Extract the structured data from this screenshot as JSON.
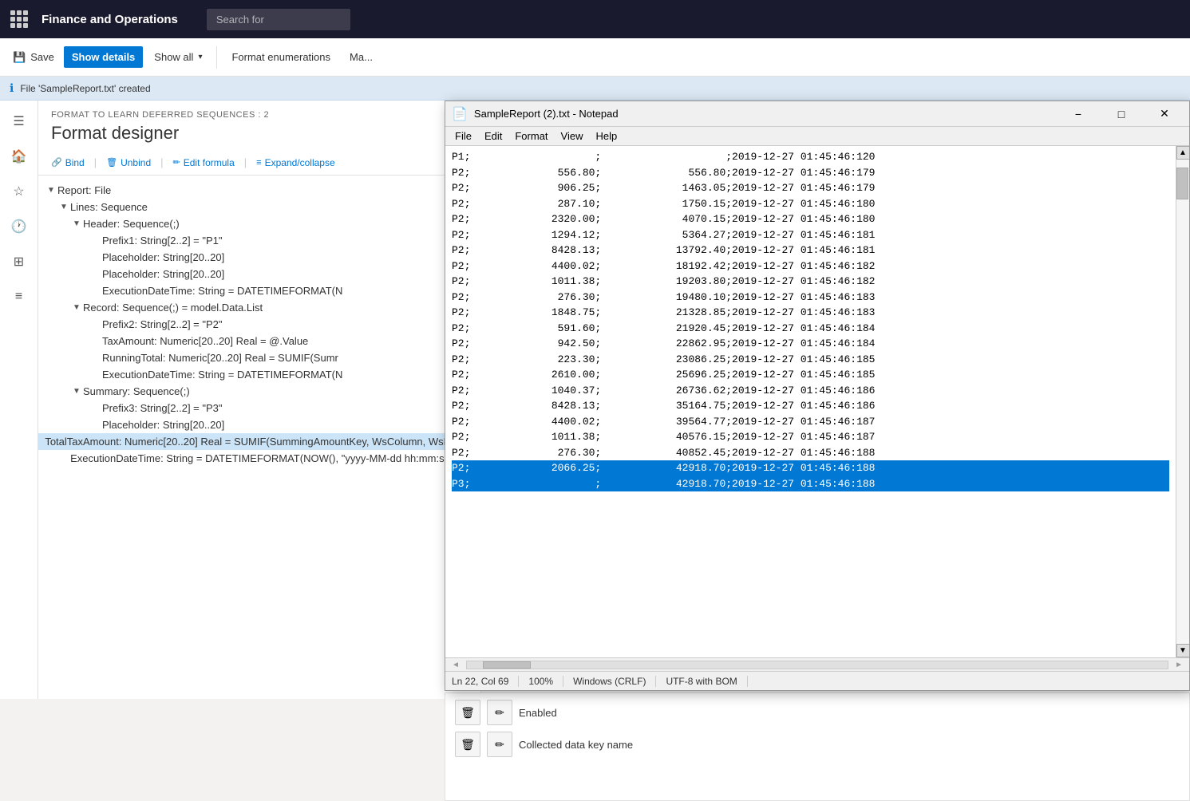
{
  "app": {
    "title": "Finance and Operations",
    "search_placeholder": "Search for"
  },
  "toolbar": {
    "save_label": "Save",
    "show_details_label": "Show details",
    "show_all_label": "Show all",
    "format_enumerations_label": "Format enumerations",
    "manage_label": "Ma..."
  },
  "info_bar": {
    "message": "File 'SampleReport.txt' created"
  },
  "designer": {
    "subtitle": "FORMAT TO LEARN DEFERRED SEQUENCES : 2",
    "title": "Format designer",
    "actions": {
      "bind": "Bind",
      "unbind": "Unbind",
      "edit_formula": "Edit formula",
      "expand_collapse": "Expand/collapse"
    },
    "tree": [
      {
        "level": 0,
        "arrow": "▼",
        "label": "Report: File",
        "indent": 0
      },
      {
        "level": 1,
        "arrow": "▼",
        "label": "Lines: Sequence",
        "indent": 16
      },
      {
        "level": 2,
        "arrow": "▼",
        "label": "Header: Sequence(;)",
        "indent": 32
      },
      {
        "level": 3,
        "arrow": "",
        "label": "Prefix1: String[2..2] = \"P1\"",
        "indent": 56
      },
      {
        "level": 3,
        "arrow": "",
        "label": "Placeholder: String[20..20]",
        "indent": 56
      },
      {
        "level": 3,
        "arrow": "",
        "label": "Placeholder: String[20..20]",
        "indent": 56
      },
      {
        "level": 3,
        "arrow": "",
        "label": "ExecutionDateTime: String = DATETIMEFORMAT(N",
        "indent": 56
      },
      {
        "level": 2,
        "arrow": "▼",
        "label": "Record: Sequence(;) = model.Data.List",
        "indent": 32
      },
      {
        "level": 3,
        "arrow": "",
        "label": "Prefix2: String[2..2] = \"P2\"",
        "indent": 56
      },
      {
        "level": 3,
        "arrow": "",
        "label": "TaxAmount: Numeric[20..20] Real = @.Value",
        "indent": 56
      },
      {
        "level": 3,
        "arrow": "",
        "label": "RunningTotal: Numeric[20..20] Real = SUMIF(Sumr",
        "indent": 56
      },
      {
        "level": 3,
        "arrow": "",
        "label": "ExecutionDateTime: String = DATETIMEFORMAT(N",
        "indent": 56
      },
      {
        "level": 2,
        "arrow": "▼",
        "label": "Summary: Sequence(;)",
        "indent": 32
      },
      {
        "level": 3,
        "arrow": "",
        "label": "Prefix3: String[2..2] = \"P3\"",
        "indent": 56
      },
      {
        "level": 3,
        "arrow": "",
        "label": "Placeholder: String[20..20]",
        "indent": 56
      },
      {
        "level": 3,
        "arrow": "",
        "label": "TotalTaxAmount: Numeric[20..20] Real = SUMIF(SummingAmountKey, WsColumn, WsRow)",
        "indent": 56,
        "selected": true
      },
      {
        "level": 3,
        "arrow": "",
        "label": "ExecutionDateTime: String = DATETIMEFORMAT(NOW(), \"yyyy-MM-dd hh:mm:ss:fff\")",
        "indent": 56
      }
    ]
  },
  "notepad": {
    "title": "SampleReport (2).txt - Notepad",
    "menu": [
      "File",
      "Edit",
      "Format",
      "View",
      "Help"
    ],
    "lines": [
      {
        "text": "P1;                    ;                    ;2019-12-27 01:45:46:120",
        "selected": false
      },
      {
        "text": "P2;              556.80;              556.80;2019-12-27 01:45:46:179",
        "selected": false
      },
      {
        "text": "P2;              906.25;             1463.05;2019-12-27 01:45:46:179",
        "selected": false
      },
      {
        "text": "P2;              287.10;             1750.15;2019-12-27 01:45:46:180",
        "selected": false
      },
      {
        "text": "P2;             2320.00;             4070.15;2019-12-27 01:45:46:180",
        "selected": false
      },
      {
        "text": "P2;             1294.12;             5364.27;2019-12-27 01:45:46:181",
        "selected": false
      },
      {
        "text": "P2;             8428.13;            13792.40;2019-12-27 01:45:46:181",
        "selected": false
      },
      {
        "text": "P2;             4400.02;            18192.42;2019-12-27 01:45:46:182",
        "selected": false
      },
      {
        "text": "P2;             1011.38;            19203.80;2019-12-27 01:45:46:182",
        "selected": false
      },
      {
        "text": "P2;              276.30;            19480.10;2019-12-27 01:45:46:183",
        "selected": false
      },
      {
        "text": "P2;             1848.75;            21328.85;2019-12-27 01:45:46:183",
        "selected": false
      },
      {
        "text": "P2;              591.60;            21920.45;2019-12-27 01:45:46:184",
        "selected": false
      },
      {
        "text": "P2;              942.50;            22862.95;2019-12-27 01:45:46:184",
        "selected": false
      },
      {
        "text": "P2;              223.30;            23086.25;2019-12-27 01:45:46:185",
        "selected": false
      },
      {
        "text": "P2;             2610.00;            25696.25;2019-12-27 01:45:46:185",
        "selected": false
      },
      {
        "text": "P2;             1040.37;            26736.62;2019-12-27 01:45:46:186",
        "selected": false
      },
      {
        "text": "P2;             8428.13;            35164.75;2019-12-27 01:45:46:186",
        "selected": false
      },
      {
        "text": "P2;             4400.02;            39564.77;2019-12-27 01:45:46:187",
        "selected": false
      },
      {
        "text": "P2;             1011.38;            40576.15;2019-12-27 01:45:46:187",
        "selected": false
      },
      {
        "text": "P2;              276.30;            40852.45;2019-12-27 01:45:46:188",
        "selected": false
      },
      {
        "text": "P2;             2066.25;            42918.70;2019-12-27 01:45:46:188",
        "selected": true
      },
      {
        "text": "P3;                    ;            42918.70;2019-12-27 01:45:46:188",
        "selected": true
      }
    ],
    "status": {
      "position": "Ln 22, Col 69",
      "zoom": "100%",
      "line_ending": "Windows (CRLF)",
      "encoding": "UTF-8 with BOM"
    }
  },
  "bottom_panel": {
    "enabled_label": "Enabled",
    "collected_key_label": "Collected data key name",
    "delete_icon": "🗑",
    "edit_icon": "✏"
  },
  "nav_icons": [
    "☰",
    "🏠",
    "★",
    "🕐",
    "▦",
    "≡"
  ]
}
